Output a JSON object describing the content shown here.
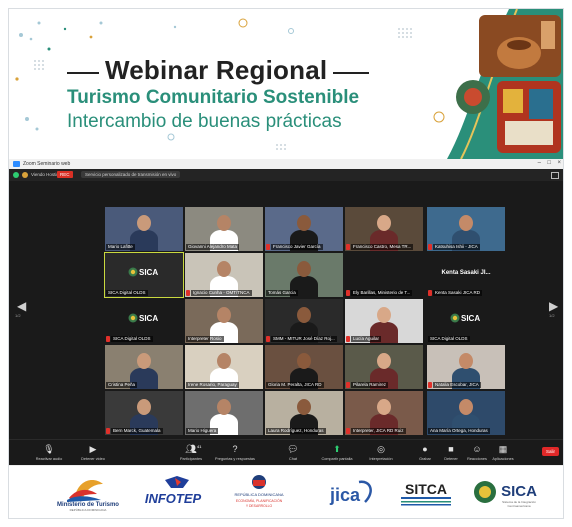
{
  "banner": {
    "title_line1": "Webinar Regional",
    "title_line2": "Turismo Comunitario Sostenible",
    "title_line3": "Intercambio de buenas prácticas"
  },
  "zoom": {
    "window_title": "Zoom Seminario web",
    "badges": {
      "recording": "REC"
    },
    "toolstrip_text": "Viendo Hosting",
    "view_chip": "Servicio personalizado de transmisión en vivo",
    "tiles": [
      {
        "name": "Mario Lafitte",
        "muted": false
      },
      {
        "name": "Giovanni Alejandro Mata",
        "muted": false
      },
      {
        "name": "Francisco Javier García",
        "muted": true
      },
      {
        "name": "Francisco Castro, Mesa TR...",
        "muted": true
      },
      {
        "name": "Katsuhisa Ishii - JICA",
        "muted": true
      },
      {
        "name": "SICA Digital OLDS",
        "muted": false
      },
      {
        "name": "Ignacio Cunha - OMT/TNCA",
        "muted": true
      },
      {
        "name": "Tomás Garcia",
        "muted": false
      },
      {
        "name": "Ely Barillas, Ministerio de T...",
        "muted": true
      },
      {
        "name": "Kenta Sasaki JICA RD",
        "muted": true,
        "center_label": "Kenta Sasaki  JI..."
      },
      {
        "name": "SICA Digital OLDS",
        "muted": true
      },
      {
        "name": "Interpreter Rosio",
        "muted": false
      },
      {
        "name": "SMM - MITUR José Díaz Roj...",
        "muted": true
      },
      {
        "name": "Lucía Aguilar",
        "muted": true
      },
      {
        "name": "SICA Digital OLDS",
        "muted": false
      },
      {
        "name": "Cristina Peña",
        "muted": false
      },
      {
        "name": "Irene Rosario, Paraguay",
        "muted": false
      },
      {
        "name": "Gloria M. Peralta, JICA RD",
        "muted": false
      },
      {
        "name": "Pilarela Ramirez",
        "muted": true
      },
      {
        "name": "Natalia Escobar, JICA",
        "muted": true
      },
      {
        "name": "Bern Marck, Guatemala",
        "muted": true
      },
      {
        "name": "Mario Higuera",
        "muted": false
      },
      {
        "name": "Laura Rodríguez, Honduras",
        "muted": false
      },
      {
        "name": "Interpreter, JICA RD Ruiz",
        "muted": true
      },
      {
        "name": "Ana María Ortega, Honduras",
        "muted": false
      }
    ],
    "pages": {
      "left": "1/2",
      "right": "1/2"
    },
    "sica_tile_logo": "SICA",
    "controls": [
      {
        "label": "Reactivar audio",
        "icon": "microphone-icon"
      },
      {
        "label": "Detener video",
        "icon": "camera-icon"
      },
      {
        "label": "Participantes",
        "icon": "people-icon",
        "count": "41"
      },
      {
        "label": "Preguntas y respuestas",
        "icon": "question-icon"
      },
      {
        "label": "Chat",
        "icon": "chat-icon"
      },
      {
        "label": "Compartir pantalla",
        "icon": "share-screen-icon"
      },
      {
        "label": "Interpretación",
        "icon": "globe-icon"
      },
      {
        "label": "Grabar",
        "icon": "record-icon"
      },
      {
        "label": "Detener",
        "icon": "stop-icon"
      },
      {
        "label": "Reacciones",
        "icon": "emoji-icon"
      },
      {
        "label": "Aplicaciones",
        "icon": "apps-icon"
      }
    ],
    "leave_label": "Salir"
  },
  "footer": {
    "logos": [
      {
        "name": "Ministerio de Turismo",
        "sub": "REPÚBLICA DOMINICANA"
      },
      {
        "name": "INFOTEP"
      },
      {
        "name": "REPÚBLICA DOMINICANA",
        "sub": "ECONOMÍA, PLANIFICACIÓN Y DESARROLLO"
      },
      {
        "name": "jica"
      },
      {
        "name": "SITCA"
      },
      {
        "name": "SICA"
      }
    ]
  }
}
